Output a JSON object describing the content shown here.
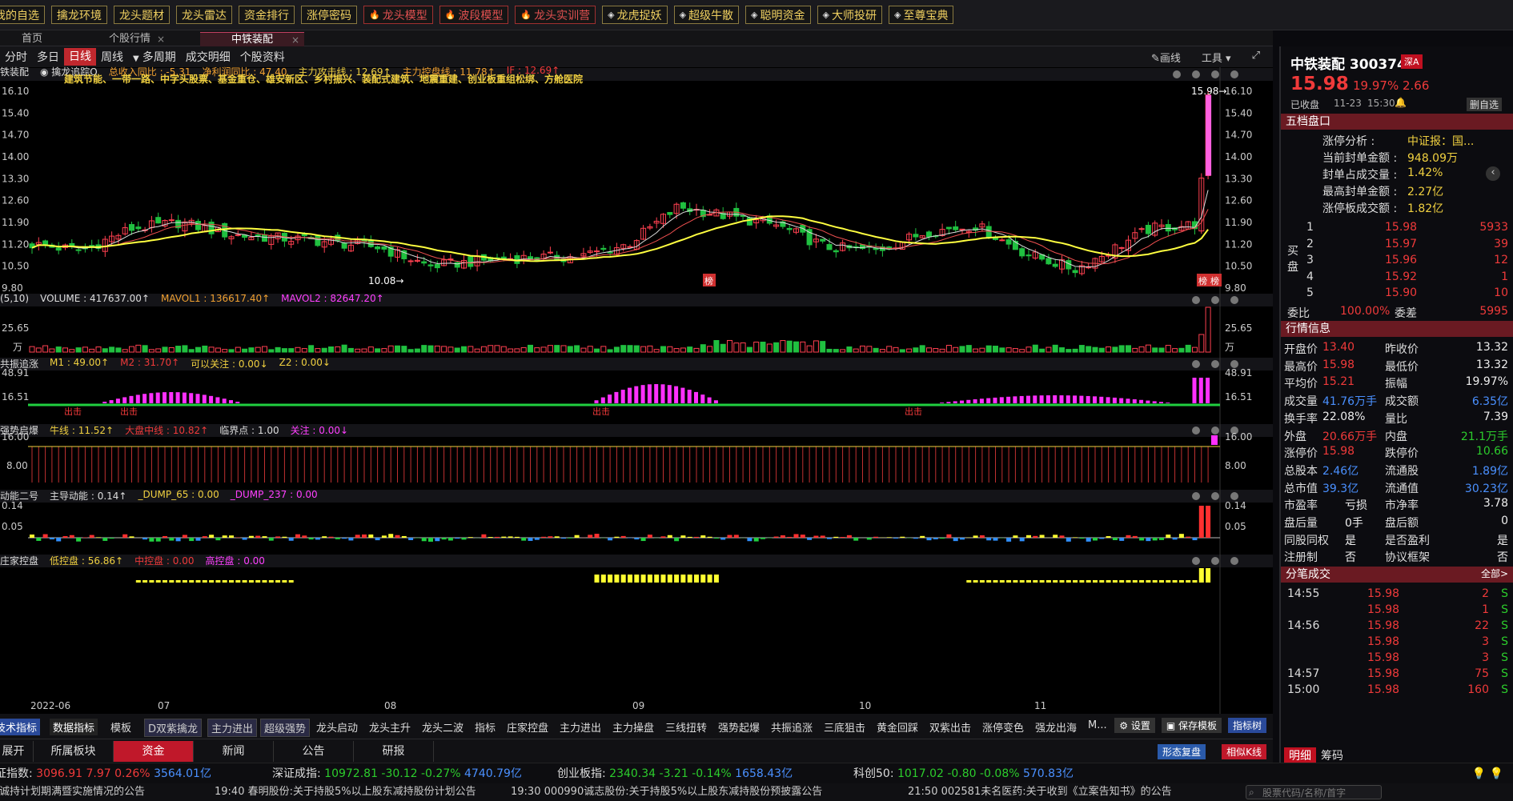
{
  "toolbar": [
    {
      "label": "我的自选",
      "style": "gold"
    },
    {
      "label": "擒龙环境",
      "style": "gold"
    },
    {
      "label": "龙头题材",
      "style": "gold"
    },
    {
      "label": "龙头雷达",
      "style": "gold"
    },
    {
      "label": "资金排行",
      "style": "gold"
    },
    {
      "label": "涨停密码",
      "style": "gold"
    },
    {
      "label": "龙头模型",
      "style": "red"
    },
    {
      "label": "波段模型",
      "style": "red"
    },
    {
      "label": "龙头实训营",
      "style": "red"
    },
    {
      "label": "龙虎捉妖",
      "style": "gold"
    },
    {
      "label": "超级牛散",
      "style": "gold"
    },
    {
      "label": "聪明资金",
      "style": "gold"
    },
    {
      "label": "大师投研",
      "style": "gold"
    },
    {
      "label": "至尊宝典",
      "style": "gold"
    }
  ],
  "tabs": [
    "首页",
    "个股行情",
    "中铁装配"
  ],
  "period_bar": {
    "items": [
      "分时",
      "多日",
      "日线",
      "周线",
      "多周期",
      "成交明细",
      "个股资料"
    ],
    "active": "日线",
    "draw": "画线",
    "tools": "工具"
  },
  "main_chart": {
    "name": "铁装配",
    "indicator": "擒龙追踪Q",
    "stats": [
      {
        "label": "总收入同比 : -5.31",
        "color": "#f0a030"
      },
      {
        "label": "净利润同比 : 47.40",
        "color": "#f0a030"
      },
      {
        "label": "主力攻击线 : 12.69↑",
        "color": "#f0d040"
      },
      {
        "label": "主力控盘线 : 11.78↑",
        "color": "#f0a030"
      },
      {
        "label": "IF : 12.69↑",
        "color": "#f03a3a"
      }
    ],
    "concepts": "建筑节能、一带一路、中字头股票、基金重仓、雄安新区、乡村振兴、装配式建筑、地震重建、创业板重组松绑、方舱医院",
    "y_ticks": [
      "16.10",
      "15.40",
      "14.70",
      "14.00",
      "13.30",
      "12.60",
      "11.90",
      "11.20",
      "10.50",
      "9.80"
    ],
    "high_label": "15.98",
    "low_label": "10.08",
    "badge": "榜"
  },
  "volume": {
    "label": "(5,10)",
    "stats": [
      "VOLUME : 417637.00↑",
      "MAVOL1 : 136617.40↑",
      "MAVOL2 : 82647.20↑"
    ],
    "y_ticks": [
      "25.65",
      "万"
    ]
  },
  "ind1": {
    "name": "共振追涨",
    "stats": [
      "M1 : 49.00↑",
      "M2 : 31.70↑",
      "可以关注 : 0.00↓",
      "Z2 : 0.00↓"
    ],
    "y_ticks": [
      "48.91",
      "16.51"
    ],
    "signal": "出击"
  },
  "ind2": {
    "name": "强势启爆",
    "stats": [
      "牛线 : 11.52↑",
      "大盘中线 : 10.82↑",
      "临界点 : 1.00",
      "关注 : 0.00↓"
    ],
    "y_ticks": [
      "16.00",
      "8.00"
    ]
  },
  "ind3": {
    "name": "动能二号",
    "stats": [
      "主导动能 : 0.14↑",
      "_DUMP_65 : 0.00",
      "_DUMP_237 : 0.00"
    ],
    "y_ticks": [
      "0.14",
      "0.05"
    ]
  },
  "ind4": {
    "name": "庄家控盘",
    "stats": [
      "低控盘 : 56.86↑",
      "中控盘 : 0.00",
      "高控盘 : 0.00"
    ]
  },
  "x_axis": [
    "2022-06",
    "07",
    "08",
    "09",
    "10",
    "11"
  ],
  "indicator_bar": {
    "items": [
      "技术指标",
      "数据指标",
      "模板",
      "D双紫擒龙",
      "主力进出",
      "超级强势",
      "龙头启动",
      "龙头主升",
      "龙头二波",
      "指标",
      "庄家控盘",
      "主力进出",
      "主力操盘",
      "三线扭转",
      "强势起爆",
      "共振追涨",
      "三底狙击",
      "黄金回踩",
      "双紫出击",
      "涨停变色",
      "强龙出海",
      "M..."
    ],
    "settings": "设置",
    "save": "保存模板",
    "tree": "指标树"
  },
  "bottom_tabs": [
    "展开",
    "所属板块",
    "资金",
    "新闻",
    "公告",
    "研报"
  ],
  "bottom_active": "资金",
  "bottom_btns": [
    "形态复盘",
    "相似K线"
  ],
  "quote": {
    "name": "中铁装配",
    "code": "300374",
    "market": "深A",
    "price": "15.98",
    "pct": "19.97%",
    "chg": "2.66",
    "status": "已收盘",
    "date": "11-23",
    "time": "15:30",
    "add_btn": "删自选",
    "five": "五档盘口",
    "zt": [
      [
        "涨停分析 : ",
        "中证报：国..."
      ],
      [
        "当前封单金额 : ",
        "948.09万"
      ],
      [
        "封单占成交量 : ",
        "1.42%"
      ],
      [
        "最高封单金额 : ",
        "2.27亿"
      ],
      [
        "涨停板成交额 : ",
        "1.82亿"
      ]
    ],
    "buy_label": "买盘",
    "bids": [
      [
        "1",
        "15.98",
        "5933"
      ],
      [
        "2",
        "15.97",
        "39"
      ],
      [
        "3",
        "15.96",
        "12"
      ],
      [
        "4",
        "15.92",
        "1"
      ],
      [
        "5",
        "15.90",
        "10"
      ]
    ],
    "weibi": [
      "委比",
      "100.00%",
      "委差",
      "5995"
    ],
    "info_title": "行情信息",
    "info": [
      [
        "开盘价",
        "13.40",
        "昨收价",
        "13.32"
      ],
      [
        "最高价",
        "15.98",
        "最低价",
        "13.32"
      ],
      [
        "平均价",
        "15.21",
        "振幅",
        "19.97%"
      ],
      [
        "成交量",
        "41.76万手",
        "成交额",
        "6.35亿"
      ],
      [
        "换手率",
        "22.08%",
        "量比",
        "7.39"
      ],
      [
        "外盘",
        "20.66万手",
        "内盘",
        "21.1万手"
      ],
      [
        "涨停价",
        "15.98",
        "跌停价",
        "10.66"
      ],
      [
        "总股本",
        "2.46亿",
        "流通股",
        "1.89亿"
      ],
      [
        "总市值",
        "39.3亿",
        "流通值",
        "30.23亿"
      ],
      [
        "市盈率",
        "亏损",
        "市净率",
        "3.78"
      ],
      [
        "盘后量",
        "0手",
        "盘后额",
        "0"
      ],
      [
        "同股同权",
        "是",
        "是否盈利",
        "是"
      ],
      [
        "注册制",
        "否",
        "协议框架",
        "否"
      ]
    ],
    "tick_title": "分笔成交",
    "tick_all": "全部>",
    "ticks": [
      [
        "14:55",
        "15.98",
        "2",
        "S"
      ],
      [
        "",
        "15.98",
        "1",
        "S"
      ],
      [
        "14:56",
        "15.98",
        "22",
        "S"
      ],
      [
        "",
        "15.98",
        "3",
        "S"
      ],
      [
        "",
        "15.98",
        "3",
        "S"
      ],
      [
        "14:57",
        "15.98",
        "75",
        "S"
      ],
      [
        "15:00",
        "15.98",
        "160",
        "S"
      ]
    ],
    "btabs": [
      "明细",
      "筹码"
    ]
  },
  "index_bar": [
    {
      "name": "上证指数:",
      "v": "3096.91",
      "c": "7.97",
      "p": "0.26%",
      "a": "3564.01亿"
    },
    {
      "name": "深证成指:",
      "v": "10972.81",
      "c": "-30.12",
      "p": "-0.27%",
      "a": "4740.79亿"
    },
    {
      "name": "创业板指:",
      "v": "2340.34",
      "c": "-3.21",
      "p": "-0.14%",
      "a": "1658.43亿"
    },
    {
      "name": "科创50:",
      "v": "1017.02",
      "c": "-0.80",
      "p": "-0.08%",
      "a": "570.83亿"
    }
  ],
  "news": [
    "东诚持计划期满暨实施情况的公告",
    "19:40 春明股份:关于持股5%以上股东减持股份计划公告",
    "19:30 000990诚志股份:关于持股5%以上股东减持股份预披露公告",
    "21:50 002581未名医药:关于收到《立案告知书》的公告"
  ],
  "search_placeholder": "股票代码/名称/首字",
  "chart_data": {
    "type": "candlestick",
    "ylim": [
      9.8,
      16.1
    ],
    "x": [
      "2022-06",
      "07",
      "08",
      "09",
      "10",
      "11"
    ]
  }
}
